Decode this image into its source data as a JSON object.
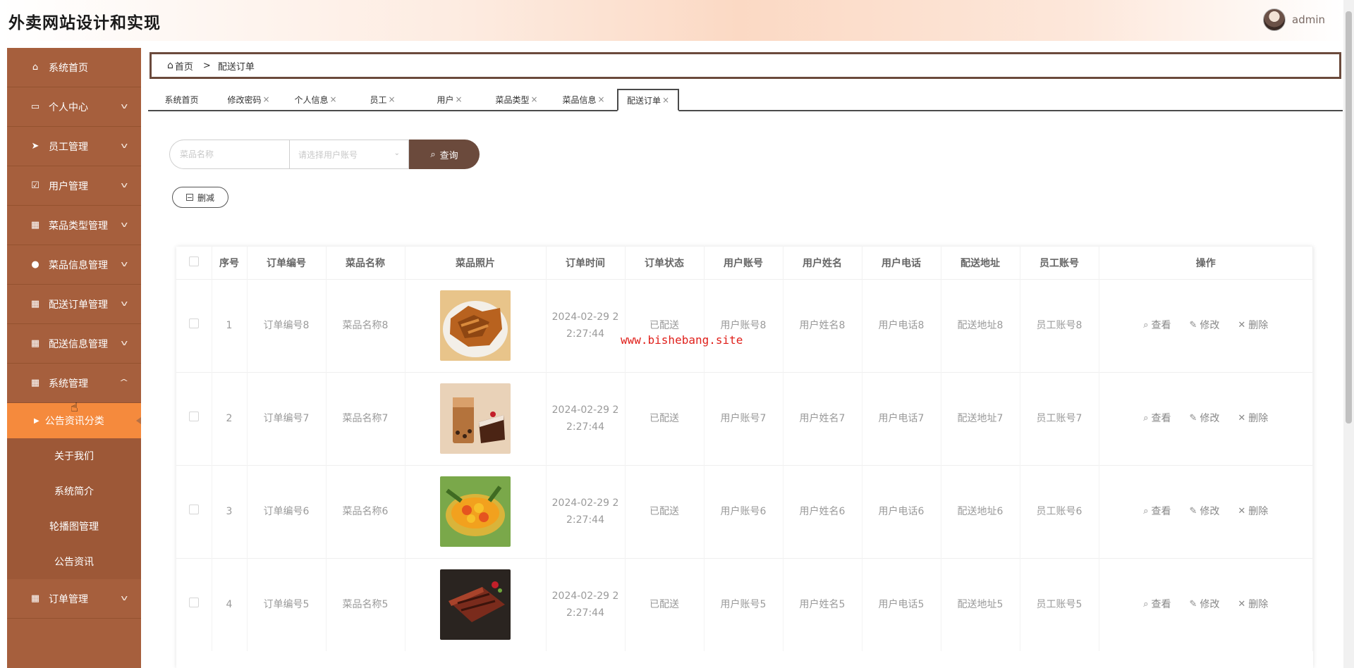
{
  "app": {
    "title": "外卖网站设计和实现"
  },
  "user": {
    "name": "admin"
  },
  "sidebar": {
    "items": [
      {
        "label": "系统首页",
        "icon": "home-icon"
      },
      {
        "label": "个人中心",
        "icon": "card-icon"
      },
      {
        "label": "员工管理",
        "icon": "send-icon"
      },
      {
        "label": "用户管理",
        "icon": "check-box-icon"
      },
      {
        "label": "菜品类型管理",
        "icon": "grid-icon"
      },
      {
        "label": "菜品信息管理",
        "icon": "person-icon"
      },
      {
        "label": "配送订单管理",
        "icon": "grid-icon"
      },
      {
        "label": "配送信息管理",
        "icon": "grid-icon"
      },
      {
        "label": "系统管理",
        "icon": "grid-icon"
      }
    ],
    "sub_items": [
      "公告资讯分类",
      "关于我们",
      "系统简介",
      "轮播图管理",
      "公告资讯"
    ],
    "last_item": {
      "label": "订单管理",
      "icon": "grid-icon"
    }
  },
  "breadcrumb": {
    "home": "首页",
    "separator": ">",
    "current": "配送订单"
  },
  "tabs": [
    "系统首页",
    "修改密码",
    "个人信息",
    "员工",
    "用户",
    "菜品类型",
    "菜品信息",
    "配送订单"
  ],
  "search": {
    "name_placeholder": "菜品名称",
    "select_placeholder": "请选择用户账号",
    "button_label": "查询"
  },
  "actions": {
    "delete_label": "删减"
  },
  "table": {
    "headers": [
      "序号",
      "订单编号",
      "菜品名称",
      "菜品照片",
      "订单时间",
      "订单状态",
      "用户账号",
      "用户姓名",
      "用户电话",
      "配送地址",
      "员工账号",
      "操作"
    ],
    "rows": [
      {
        "no": "1",
        "order_no": "订单编号8",
        "dish": "菜品名称8",
        "time": "2024-02-29 2\n2:27:44",
        "status": "已配送",
        "account": "用户账号8",
        "uname": "用户姓名8",
        "phone": "用户电话8",
        "address": "配送地址8",
        "staff": "员工账号8"
      },
      {
        "no": "2",
        "order_no": "订单编号7",
        "dish": "菜品名称7",
        "time": "2024-02-29 2\n2:27:44",
        "status": "已配送",
        "account": "用户账号7",
        "uname": "用户姓名7",
        "phone": "用户电话7",
        "address": "配送地址7",
        "staff": "员工账号7"
      },
      {
        "no": "3",
        "order_no": "订单编号6",
        "dish": "菜品名称6",
        "time": "2024-02-29 2\n2:27:44",
        "status": "已配送",
        "account": "用户账号6",
        "uname": "用户姓名6",
        "phone": "用户电话6",
        "address": "配送地址6",
        "staff": "员工账号6"
      },
      {
        "no": "4",
        "order_no": "订单编号5",
        "dish": "菜品名称5",
        "time": "2024-02-29 2\n2:27:44",
        "status": "已配送",
        "account": "用户账号5",
        "uname": "用户姓名5",
        "phone": "用户电话5",
        "address": "配送地址5",
        "staff": "员工账号5"
      }
    ],
    "op_labels": {
      "view": "查看",
      "edit": "修改",
      "delete": "删除"
    }
  },
  "watermark": "www.bishebang.site",
  "colors": {
    "sidebar": "#a65f3d",
    "active": "#f58a3d",
    "dark": "#6b4a3c",
    "watermark": "#e0201b"
  }
}
